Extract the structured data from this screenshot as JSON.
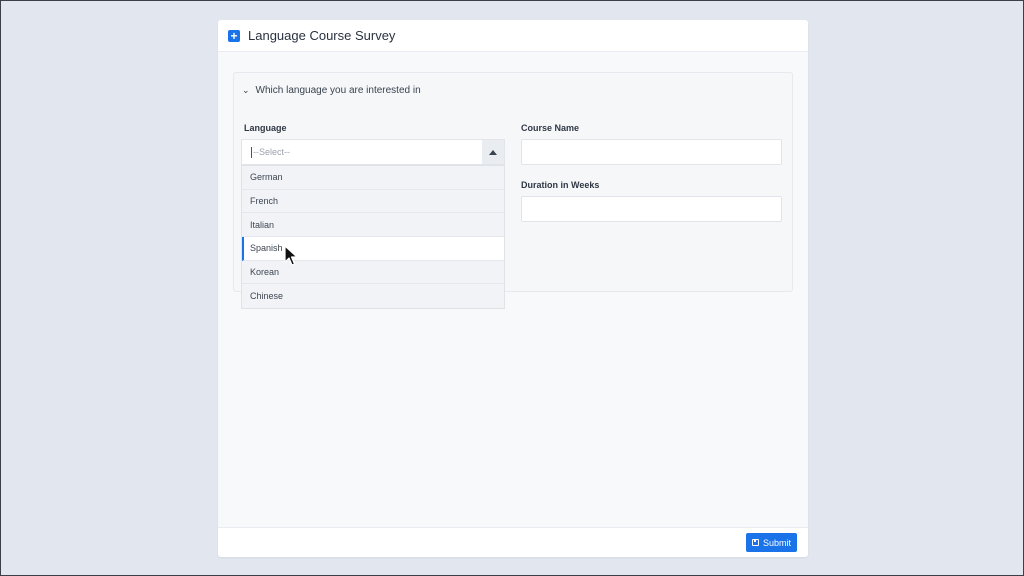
{
  "window": {
    "title": "Language Course Survey"
  },
  "section": {
    "toggle_label": "Which language you are interested in"
  },
  "fields": {
    "language_label": "Language",
    "language_placeholder": "--Select--",
    "course_name_label": "Course Name",
    "course_name_value": "",
    "duration_label": "Duration in Weeks",
    "duration_value": ""
  },
  "dropdown": {
    "options": [
      "German",
      "French",
      "Italian",
      "Spanish",
      "Korean",
      "Chinese"
    ],
    "hovered": "Spanish"
  },
  "footer": {
    "submit_label": "Submit"
  },
  "icons": {
    "header": "plus-square-icon",
    "toggle": "chevron-down-icon",
    "select_arrow": "caret-up-icon",
    "submit": "save-icon"
  },
  "colors": {
    "accent": "#1a73e8",
    "background": "#e2e6ee"
  }
}
